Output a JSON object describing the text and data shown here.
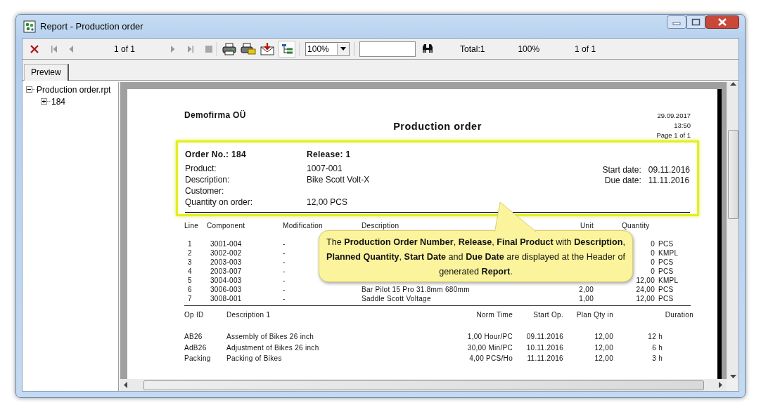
{
  "window": {
    "title": "Report - Production order"
  },
  "toolbar": {
    "page_indicator": "1 of 1",
    "zoom": "100%",
    "status": [
      "Total:1",
      "100%",
      "1 of 1"
    ],
    "tree_toggle_on": true
  },
  "tabs": [
    {
      "label": "Preview",
      "selected": true
    }
  ],
  "tree": [
    {
      "label": "Production order.rpt",
      "expanded": true,
      "children": [
        {
          "label": "184",
          "expanded": false
        }
      ]
    }
  ],
  "report": {
    "company": "Demofirma OÜ",
    "title": "Production order",
    "date": "29.09.2017",
    "time": "13:50",
    "page": "Page 1 of 1",
    "header": {
      "highlighted": true,
      "order_no": "Order No.: 184",
      "release": "Release: 1",
      "left_fields": [
        {
          "label": "Product:",
          "value": "1007-001"
        },
        {
          "label": "Description:",
          "value": "Bike Scott Volt-X"
        },
        {
          "label": "Customer:"
        },
        {
          "label": "Quantity on order:",
          "value": "12,00  PCS"
        }
      ],
      "right_fields": [
        {
          "label": "Start date:",
          "value": "09.11.2016"
        },
        {
          "label": "Due date:",
          "value": "11.11.2016"
        }
      ]
    },
    "components": {
      "columns": [
        "Line",
        "Component",
        "Modification",
        "Description",
        "Unit",
        "Quantity"
      ],
      "rows": [
        {
          "line": "1",
          "component": "3001-004",
          "modification": "-",
          "amount": "0",
          "unit": "PCS"
        },
        {
          "line": "2",
          "component": "3002-002",
          "modification": "-",
          "amount": "0",
          "unit": "KMPL"
        },
        {
          "line": "3",
          "component": "2003-003",
          "modification": "-",
          "amount": "0",
          "unit": "PCS"
        },
        {
          "line": "4",
          "component": "2003-007",
          "modification": "-",
          "amount": "0",
          "unit": "PCS"
        },
        {
          "line": "5",
          "component": "3004-003",
          "modification": "-",
          "amount": "12,00",
          "unit": "KMPL"
        },
        {
          "line": "6",
          "component": "3006-003",
          "modification": "-",
          "description": "Bar Pilot 15 Pro 31.8mm 680mm",
          "qty": "2,00",
          "amount": "24,00",
          "unit": "PCS"
        },
        {
          "line": "7",
          "component": "3008-001",
          "modification": "-",
          "description": "Saddle Scott Voltage",
          "qty": "1,00",
          "amount": "12,00",
          "unit": "PCS"
        }
      ]
    },
    "operations": {
      "columns": [
        "Op ID",
        "Description 1",
        "Norm Time",
        "Start Op.",
        "Plan Qty in",
        "Duration"
      ],
      "rows": [
        {
          "op_id": "AB26",
          "description": "Assembly of Bikes 26 inch",
          "norm_time": "1,00 Hour/PC",
          "start": "09.11.2016",
          "plan_qty": "12,00",
          "duration": "12 h"
        },
        {
          "op_id": "AdB26",
          "description": "Adjustment of Bikes 26 inch",
          "norm_time": "30,00 Min/PC",
          "start": "10.11.2016",
          "plan_qty": "12,00",
          "duration": "6 h"
        },
        {
          "op_id": "Packing",
          "description": "Packing of Bikes",
          "norm_time": "4,00 PCS/Ho",
          "start": "11.11.2016",
          "plan_qty": "12,00",
          "duration": "3 h"
        }
      ]
    },
    "callout": {
      "text": "The **Production Order Number**, **Release**, **Final Product** with **Description**, **Planned Quantity**, **Start Date** and **Due Date** are displayed at the Header of generated **Report**."
    }
  }
}
